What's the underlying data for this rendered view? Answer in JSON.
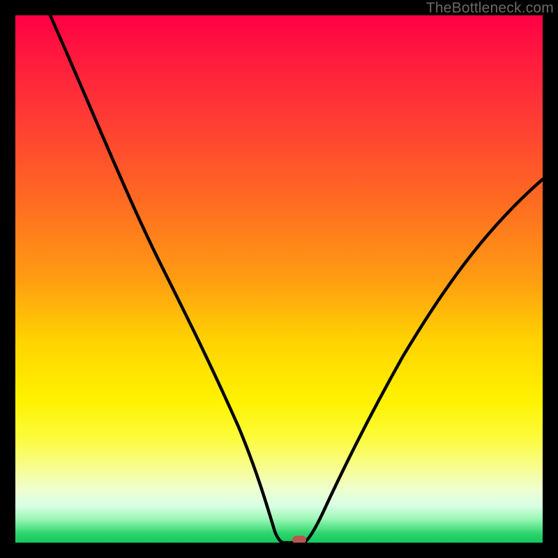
{
  "watermark": "TheBottleneck.com",
  "colors": {
    "gradient_top": "#ff0044",
    "gradient_mid": "#ffd400",
    "gradient_bottom": "#13c95b",
    "curve": "#000000",
    "marker_fill": "#b9554e",
    "frame": "#000000"
  },
  "chart_data": {
    "type": "line",
    "title": "",
    "xlabel": "",
    "ylabel": "",
    "xlim": [
      0,
      100
    ],
    "ylim": [
      0,
      100
    ],
    "x": [
      0,
      5,
      10,
      15,
      20,
      25,
      30,
      35,
      40,
      45,
      48,
      50,
      52,
      55,
      60,
      65,
      70,
      75,
      80,
      85,
      90,
      95,
      100
    ],
    "values": [
      100,
      92,
      84,
      76,
      69,
      61,
      52,
      42,
      32,
      18,
      6,
      1,
      0,
      0,
      7,
      16,
      25,
      33,
      41,
      48,
      55,
      62,
      68
    ],
    "marker": {
      "x": 53,
      "y": 0
    },
    "grid": false
  }
}
